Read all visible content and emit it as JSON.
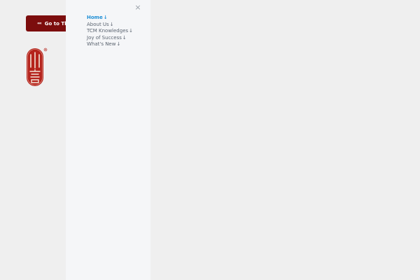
{
  "cta": {
    "arrow": "««",
    "label": "Go to The"
  },
  "drawer": {
    "close_icon": "×",
    "menu": [
      {
        "label": "Home",
        "chevron": "↓",
        "active": true
      },
      {
        "label": "About Us",
        "chevron": "↓",
        "active": false
      },
      {
        "label": "TCM Knowledges",
        "chevron": "↓",
        "active": false
      },
      {
        "label": "Joy of Success",
        "chevron": "↓",
        "active": false
      },
      {
        "label": "What's New",
        "chevron": "↓",
        "active": false
      }
    ]
  },
  "colors": {
    "page_bg": "#efefef",
    "drawer_bg": "#f5f6f8",
    "brand_red": "#7c0d0d",
    "active_link": "#1f8fd6",
    "menu_text": "#5b6470"
  },
  "icons": {
    "logo": "seal-logo-icon",
    "close": "close-icon",
    "cta_arrow": "double-chevron-left-icon",
    "menu_chevron": "arrow-down-icon"
  }
}
